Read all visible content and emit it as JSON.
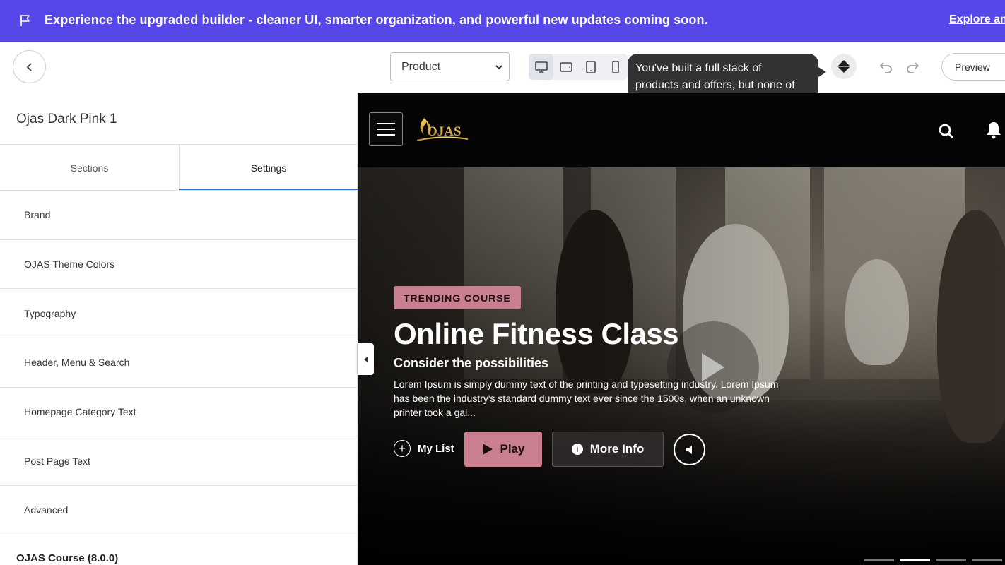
{
  "banner": {
    "text": "Experience the upgraded builder - cleaner UI, smarter organization, and powerful new updates coming soon.",
    "link": "Explore an"
  },
  "toolbar": {
    "page_select_value": "Product",
    "tooltip_line1": "You've built a full stack of",
    "tooltip_line2": "products and offers, but none of",
    "preview_label": "Preview"
  },
  "sidebar": {
    "theme_name": "Ojas Dark Pink 1",
    "tabs": [
      {
        "label": "Sections"
      },
      {
        "label": "Settings"
      }
    ],
    "items": [
      {
        "label": "Brand"
      },
      {
        "label": "OJAS Theme Colors"
      },
      {
        "label": "Typography"
      },
      {
        "label": "Header, Menu & Search"
      },
      {
        "label": "Homepage Category Text"
      },
      {
        "label": "Post Page Text"
      },
      {
        "label": "Advanced"
      }
    ],
    "version": "OJAS Course (8.0.0)"
  },
  "site": {
    "logo_text": "OJAS",
    "hero": {
      "badge": "TRENDING COURSE",
      "title": "Online Fitness Class",
      "subtitle": "Consider the possibilities",
      "description": "Lorem Ipsum is simply dummy text of the printing and typesetting industry. Lorem Ipsum has been the industry's standard dummy text ever since the 1500s, when an unknown printer took a gal...",
      "my_list": "My List",
      "play": "Play",
      "more_info": "More Info"
    }
  },
  "colors": {
    "banner": "#5647e8",
    "accent_pink": "#c97f8f",
    "tab_underline": "#1f73d6"
  }
}
